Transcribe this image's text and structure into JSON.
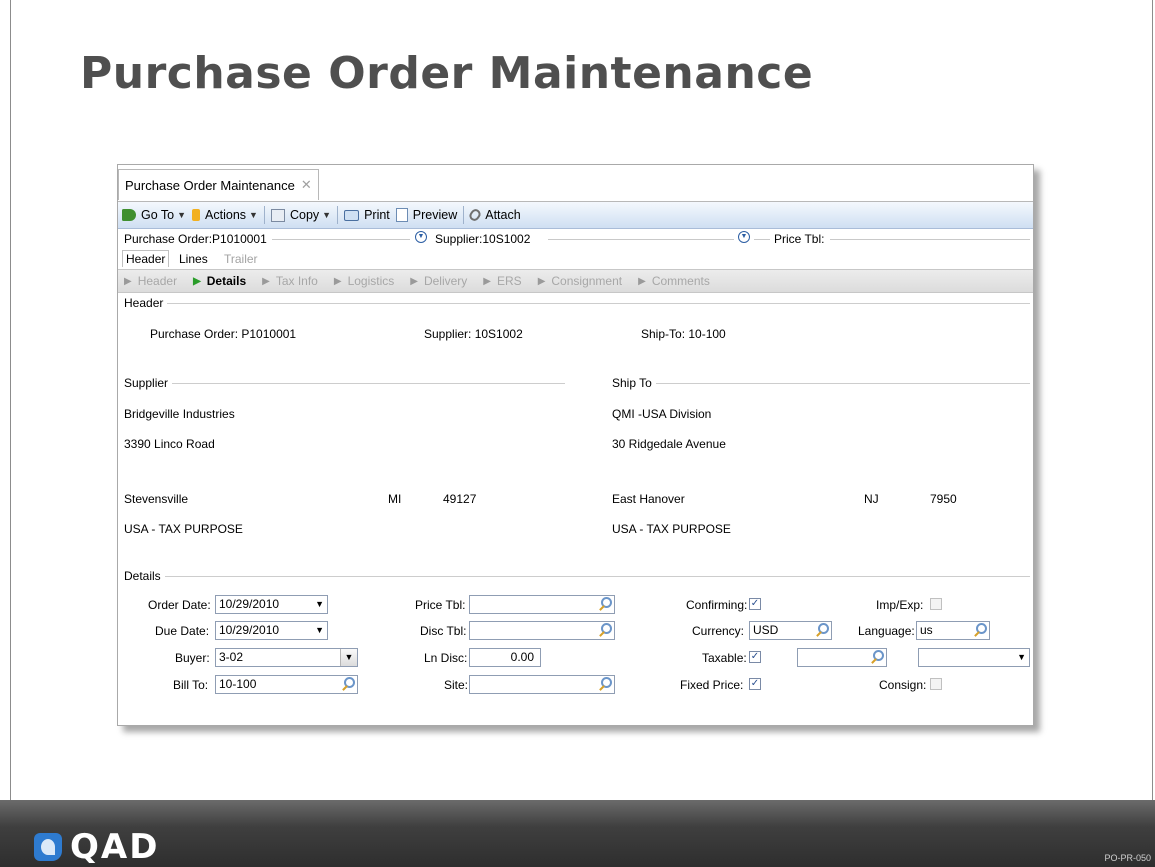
{
  "slide": {
    "title": "Purchase Order Maintenance",
    "logo_text": "QAD",
    "code": "PO-PR-050"
  },
  "window": {
    "tab_label": "Purchase Order Maintenance",
    "toolbar": [
      "Go To",
      "Actions",
      "Copy",
      "Print",
      "Preview",
      "Attach"
    ],
    "key": {
      "po_label": "Purchase Order:P1010001",
      "supplier_label": "Supplier:10S1002",
      "price_label": "Price Tbl:"
    },
    "subtabs": [
      "Header",
      "Lines",
      "Trailer"
    ],
    "sections": [
      "Header",
      "Details",
      "Tax Info",
      "Logistics",
      "Delivery",
      "ERS",
      "Consignment",
      "Comments"
    ],
    "header_group": {
      "label": "Header",
      "po": "Purchase Order:  P1010001",
      "supplier": "Supplier:  10S1002",
      "shipto": "Ship-To:  10-100"
    },
    "supplier_group": {
      "label": "Supplier",
      "name": "Bridgeville Industries",
      "address": "3390 Linco Road",
      "city": "Stevensville",
      "state": "MI",
      "zip": "49127",
      "country": "USA - TAX PURPOSE"
    },
    "shipto_group": {
      "label": "Ship To",
      "name": "QMI -USA Division",
      "address": "30 Ridgedale Avenue",
      "city": "East Hanover",
      "state": "NJ",
      "zip": "7950",
      "country": "USA - TAX PURPOSE"
    },
    "details": {
      "label": "Details",
      "order_date_label": "Order Date:",
      "order_date": "10/29/2010",
      "due_date_label": "Due Date:",
      "due_date": "10/29/2010",
      "buyer_label": "Buyer:",
      "buyer": "3-02",
      "bill_to_label": "Bill To:",
      "bill_to": "10-100",
      "price_tbl_label": "Price Tbl:",
      "disc_tbl_label": "Disc Tbl:",
      "ln_disc_label": "Ln Disc:",
      "ln_disc": "0.00",
      "site_label": "Site:",
      "confirming_label": "Confirming:",
      "confirming": true,
      "currency_label": "Currency:",
      "currency": "USD",
      "taxable_label": "Taxable:",
      "taxable": true,
      "fixed_price_label": "Fixed Price:",
      "fixed_price": true,
      "imp_exp_label": "Imp/Exp:",
      "imp_exp": false,
      "language_label": "Language:",
      "language": "us",
      "consign_label": "Consign:",
      "consign": false
    }
  }
}
